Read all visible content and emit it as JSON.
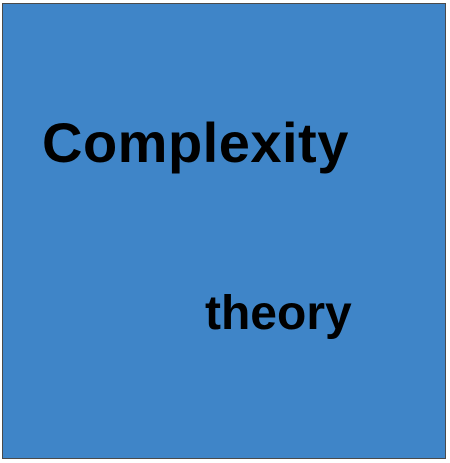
{
  "tile": {
    "background_color": "#3f85c8",
    "border_color": "#4a4a4a",
    "text_color": "#000000",
    "line1": "Complexity",
    "line2": "theory"
  }
}
